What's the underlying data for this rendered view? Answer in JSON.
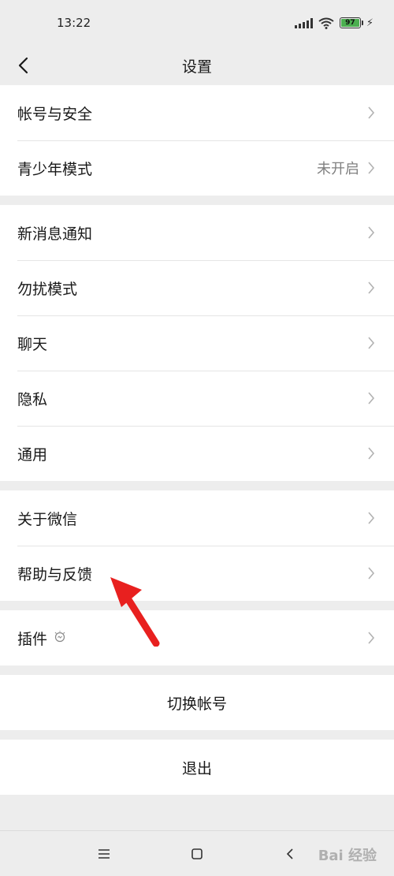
{
  "status_bar": {
    "time": "13:22",
    "battery": "97"
  },
  "nav": {
    "title": "设置"
  },
  "groups": [
    {
      "items": [
        {
          "label": "帐号与安全",
          "value": ""
        },
        {
          "label": "青少年模式",
          "value": "未开启"
        }
      ]
    },
    {
      "items": [
        {
          "label": "新消息通知",
          "value": ""
        },
        {
          "label": "勿扰模式",
          "value": ""
        },
        {
          "label": "聊天",
          "value": ""
        },
        {
          "label": "隐私",
          "value": ""
        },
        {
          "label": "通用",
          "value": ""
        }
      ]
    },
    {
      "items": [
        {
          "label": "关于微信",
          "value": ""
        },
        {
          "label": "帮助与反馈",
          "value": ""
        }
      ]
    },
    {
      "items": [
        {
          "label": "插件",
          "value": "",
          "icon": "plugin-bulb-icon"
        }
      ]
    }
  ],
  "actions": {
    "switch_account": "切换帐号",
    "logout": "退出"
  },
  "watermark": "Bai 经验",
  "colors": {
    "accent_arrow": "#e8201f",
    "battery": "#4caf50"
  }
}
